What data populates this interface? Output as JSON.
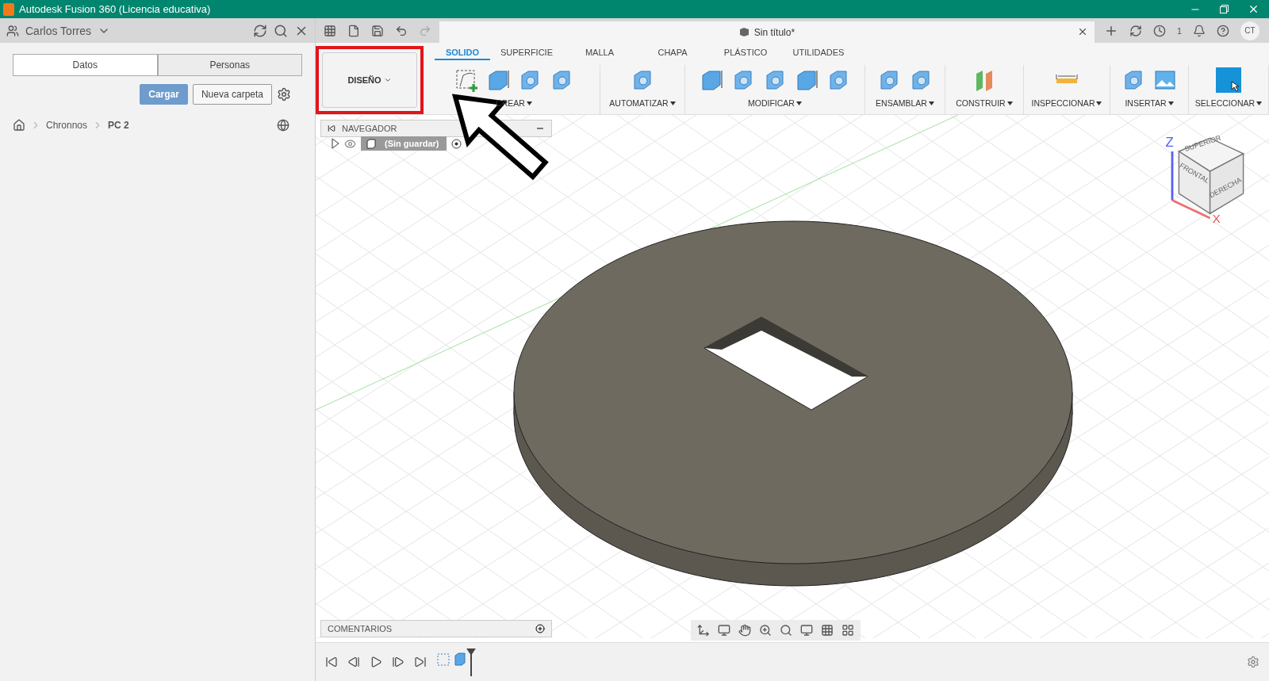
{
  "window": {
    "title": "Autodesk Fusion 360 (Licencia educativa)"
  },
  "data_panel": {
    "user": "Carlos Torres",
    "tabs": [
      {
        "label": "Datos",
        "selected": true
      },
      {
        "label": "Personas",
        "selected": false
      }
    ],
    "buttons": [
      {
        "label": "Cargar",
        "kind": "primary"
      },
      {
        "label": "Nueva carpeta",
        "kind": "secondary"
      }
    ],
    "breadcrumb": [
      "Chronnos",
      "PC 2"
    ]
  },
  "document": {
    "title": "Sin título*",
    "jobs": "1",
    "avatar": "CT"
  },
  "workspace": {
    "label": "DISEÑO"
  },
  "ribbon_tabs": [
    {
      "label": "SOLIDO",
      "selected": true
    },
    {
      "label": "SUPERFICIE",
      "selected": false
    },
    {
      "label": "MALLA",
      "selected": false
    },
    {
      "label": "CHAPA",
      "selected": false
    },
    {
      "label": "PLÁSTICO",
      "selected": false
    },
    {
      "label": "UTILIDADES",
      "selected": false
    }
  ],
  "ribbon_groups": [
    {
      "label": "CREAR"
    },
    {
      "label": "AUTOMATIZAR"
    },
    {
      "label": "MODIFICAR"
    },
    {
      "label": "ENSAMBLAR"
    },
    {
      "label": "CONSTRUIR"
    },
    {
      "label": "INSPECCIONAR"
    },
    {
      "label": "INSERTAR"
    },
    {
      "label": "SELECCIONAR"
    }
  ],
  "browser": {
    "title": "NAVEGADOR",
    "root": {
      "label": "(Sin guardar)",
      "expanded": false
    }
  },
  "comments": {
    "title": "COMENTARIOS"
  },
  "viewcube": {
    "faces": [
      "SUPERIOR",
      "FRONTAL",
      "DERECHA"
    ],
    "axes": [
      "Z",
      "X"
    ]
  }
}
